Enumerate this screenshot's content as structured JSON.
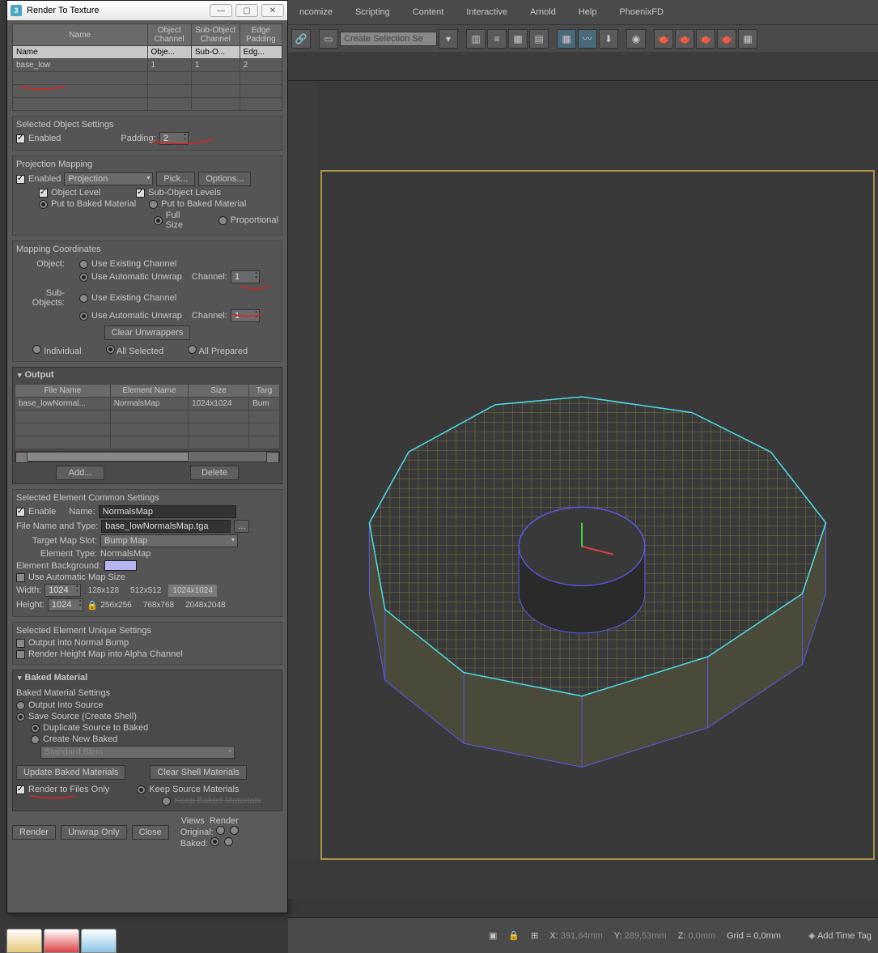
{
  "dialog": {
    "title": "Render To Texture",
    "table": {
      "headers_top": [
        "Name",
        "Object Channel",
        "Sub-Object Channel",
        "Edge Padding"
      ],
      "headers": [
        "Name",
        "Obje...",
        "Sub-O...",
        "Edg..."
      ],
      "rows": [
        {
          "name": "base_low",
          "obj": "1",
          "sub": "1",
          "edge": "2"
        }
      ]
    },
    "sel_obj": {
      "title": "Selected Object Settings",
      "enabled": "Enabled",
      "padding_lbl": "Padding:",
      "padding_val": "2"
    },
    "proj_map": {
      "title": "Projection Mapping",
      "enabled": "Enabled",
      "dd": "Projection",
      "pick": "Pick...",
      "options": "Options...",
      "obj_level": "Object Level",
      "sub_level": "Sub-Object Levels",
      "put_baked": "Put to Baked Material",
      "full": "Full Size",
      "prop": "Proportional"
    },
    "map_coord": {
      "title": "Mapping Coordinates",
      "object": "Object:",
      "sub": "Sub-Objects:",
      "use_exist": "Use Existing Channel",
      "use_auto": "Use Automatic Unwrap",
      "channel": "Channel:",
      "ch_val": "1",
      "clear": "Clear Unwrappers",
      "individual": "Individual",
      "all_sel": "All Selected",
      "all_prep": "All Prepared"
    },
    "output": {
      "title": "Output",
      "headers": [
        "File Name",
        "Element Name",
        "Size",
        "Targ"
      ],
      "rows": [
        {
          "fn": "base_lowNormal...",
          "en": "NormalsMap",
          "sz": "1024x1024",
          "tg": "Bum"
        }
      ],
      "add": "Add...",
      "del": "Delete"
    },
    "elem_common": {
      "title": "Selected Element Common Settings",
      "enable": "Enable",
      "name_lbl": "Name:",
      "name_val": "NormalsMap",
      "fnt_lbl": "File Name and Type:",
      "fnt_val": "base_lowNormalsMap.tga",
      "slot_lbl": "Target Map Slot:",
      "slot_val": "Bump Map",
      "et_lbl": "Element Type:",
      "et_val": "NormalsMap",
      "eb": "Element Background:",
      "auto": "Use Automatic Map Size",
      "w": "Width:",
      "h": "Height:",
      "wv": "1024",
      "hv": "1024",
      "p128": "128x128",
      "p256": "256x256",
      "p512": "512x512",
      "p768": "768x768",
      "p1024": "1024x1024",
      "p2048": "2048x2048"
    },
    "elem_unique": {
      "title": "Selected Element Unique Settings",
      "o1": "Output into Normal Bump",
      "o2": "Render Height Map into Alpha Channel"
    },
    "baked": {
      "title": "Baked Material",
      "sub": "Baked Material Settings",
      "o1": "Output Into Source",
      "o2": "Save Source (Create Shell)",
      "d1": "Duplicate Source to Baked",
      "d2": "Create New Baked",
      "shader": "Standard:Blinn",
      "upd": "Update Baked Materials",
      "clr": "Clear Shell Materials",
      "rtf": "Render to Files Only",
      "ksm": "Keep Source Materials",
      "kbm": "Keep Baked Materials",
      "views": "Views",
      "rend": "Render",
      "orig": "Original:",
      "bk": "Baked:"
    },
    "btns": {
      "render": "Render",
      "unwrap": "Unwrap Only",
      "close": "Close"
    }
  },
  "menus": [
    "ncomize",
    "Scripting",
    "Content",
    "Interactive",
    "Arnold",
    "Help",
    "PhoenixFD"
  ],
  "selset": "Create Selection Se",
  "status": {
    "x_lbl": "X:",
    "x": "391,64mm",
    "y_lbl": "Y:",
    "y": "289,53mm",
    "z_lbl": "Z:",
    "z": "0,0mm",
    "grid": "Grid = 0,0mm",
    "add_tag": "Add Time Tag"
  }
}
